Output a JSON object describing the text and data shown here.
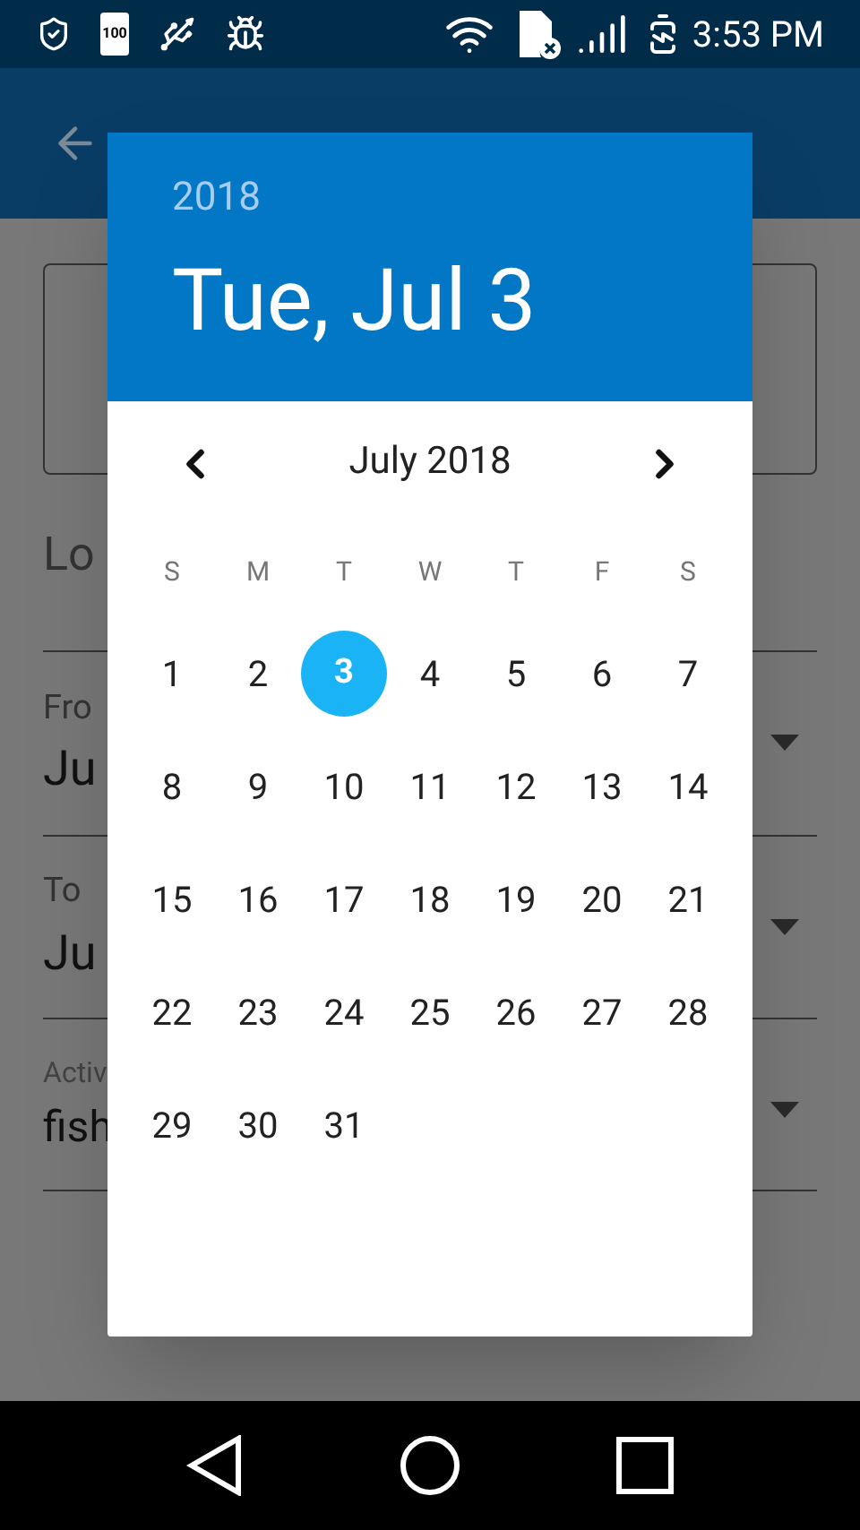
{
  "status_bar": {
    "battery_level_label": "100",
    "time": "3:53 PM"
  },
  "background": {
    "location_label": "Lo",
    "from_label": "Fro",
    "from_value": "Ju",
    "to_label": "To",
    "to_value": "Ju",
    "activity_label": "Activ",
    "activity_value": "fish"
  },
  "date_dialog": {
    "year": "2018",
    "date": "Tue, Jul 3",
    "month": "July 2018",
    "weekdays": [
      "S",
      "M",
      "T",
      "W",
      "T",
      "F",
      "S"
    ],
    "weeks": [
      [
        {
          "label": "1",
          "selected": false
        },
        {
          "label": "2",
          "selected": false
        },
        {
          "label": "3",
          "selected": true
        },
        {
          "label": "4",
          "selected": false
        },
        {
          "label": "5",
          "selected": false
        },
        {
          "label": "6",
          "selected": false
        },
        {
          "label": "7",
          "selected": false
        }
      ],
      [
        {
          "label": "8",
          "selected": false
        },
        {
          "label": "9",
          "selected": false
        },
        {
          "label": "10",
          "selected": false
        },
        {
          "label": "11",
          "selected": false
        },
        {
          "label": "12",
          "selected": false
        },
        {
          "label": "13",
          "selected": false
        },
        {
          "label": "14",
          "selected": false
        }
      ],
      [
        {
          "label": "15",
          "selected": false
        },
        {
          "label": "16",
          "selected": false
        },
        {
          "label": "17",
          "selected": false
        },
        {
          "label": "18",
          "selected": false
        },
        {
          "label": "19",
          "selected": false
        },
        {
          "label": "20",
          "selected": false
        },
        {
          "label": "21",
          "selected": false
        }
      ],
      [
        {
          "label": "22",
          "selected": false
        },
        {
          "label": "23",
          "selected": false
        },
        {
          "label": "24",
          "selected": false
        },
        {
          "label": "25",
          "selected": false
        },
        {
          "label": "26",
          "selected": false
        },
        {
          "label": "27",
          "selected": false
        },
        {
          "label": "28",
          "selected": false
        }
      ],
      [
        {
          "label": "29",
          "selected": false
        },
        {
          "label": "30",
          "selected": false
        },
        {
          "label": "31",
          "selected": false
        }
      ]
    ]
  }
}
